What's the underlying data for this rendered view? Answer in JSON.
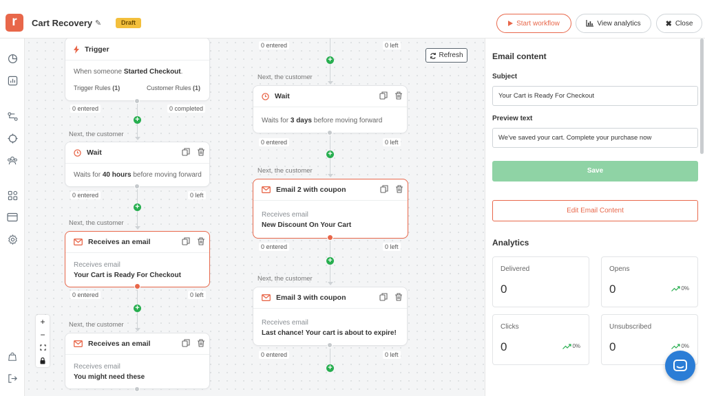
{
  "header": {
    "logo_letter": "r",
    "title": "Cart Recovery",
    "status_badge": "Draft",
    "start_workflow": "Start workflow",
    "view_analytics": "View analytics",
    "close": "Close"
  },
  "canvas": {
    "refresh": "Refresh",
    "next_label": "Next, the customer",
    "trigger": {
      "title": "Trigger",
      "desc_prefix": "When someone ",
      "desc_event": "Started Checkout",
      "desc_suffix": ".",
      "trigger_rules": "Trigger Rules",
      "trigger_rules_count": "(1)",
      "customer_rules": "Customer Rules",
      "customer_rules_count": "(1)",
      "entered": "0 entered",
      "completed": "0 completed"
    },
    "wait1": {
      "title": "Wait",
      "prefix": "Waits for ",
      "duration": "40 hours",
      "suffix": " before moving forward",
      "entered": "0 entered",
      "left": "0 left"
    },
    "email1": {
      "title": "Receives an email",
      "sub": "Receives email",
      "name": "Your Cart is Ready For Checkout",
      "entered": "0 entered",
      "left": "0 left"
    },
    "email_bottom": {
      "title": "Receives an email",
      "sub": "Receives email",
      "name": "You might need these"
    },
    "col2_top": {
      "entered": "0 entered",
      "left": "0 left"
    },
    "wait2": {
      "title": "Wait",
      "prefix": "Waits for ",
      "duration": "3 days",
      "suffix": " before moving forward",
      "entered": "0 entered",
      "left": "0 left"
    },
    "email2": {
      "title": "Email 2 with coupon",
      "sub": "Receives email",
      "name": "New Discount On Your Cart",
      "entered": "0 entered",
      "left": "0 left"
    },
    "email3": {
      "title": "Email 3 with coupon",
      "sub": "Receives email",
      "name": "Last chance! Your cart is about to expire!",
      "entered": "0 entered",
      "left": "0 left"
    },
    "zoom": {
      "in": "+",
      "out": "−"
    }
  },
  "panel": {
    "title": "Email content",
    "subject_label": "Subject",
    "subject_value": "Your Cart is Ready For Checkout",
    "preview_label": "Preview text",
    "preview_value": "We've saved your cart. Complete your purchase now",
    "save": "Save",
    "edit": "Edit Email Content",
    "analytics_title": "Analytics",
    "stats": [
      {
        "label": "Delivered",
        "value": "0",
        "trend": ""
      },
      {
        "label": "Opens",
        "value": "0",
        "trend": "0%"
      },
      {
        "label": "Clicks",
        "value": "0",
        "trend": "0%"
      },
      {
        "label": "Unsubscribed",
        "value": "0",
        "trend": "0%"
      }
    ]
  },
  "colors": {
    "accent": "#e8674a",
    "success": "#27ae4f",
    "badge": "#f3bf3c",
    "chat": "#2b7dd6"
  },
  "icons": [
    "pencil-icon",
    "play-icon",
    "chart-icon",
    "close-icon",
    "clock-icon",
    "mail-icon",
    "copy-icon",
    "trash-icon",
    "bolt-icon",
    "refresh-icon",
    "trend-up-icon",
    "chat-icon"
  ]
}
